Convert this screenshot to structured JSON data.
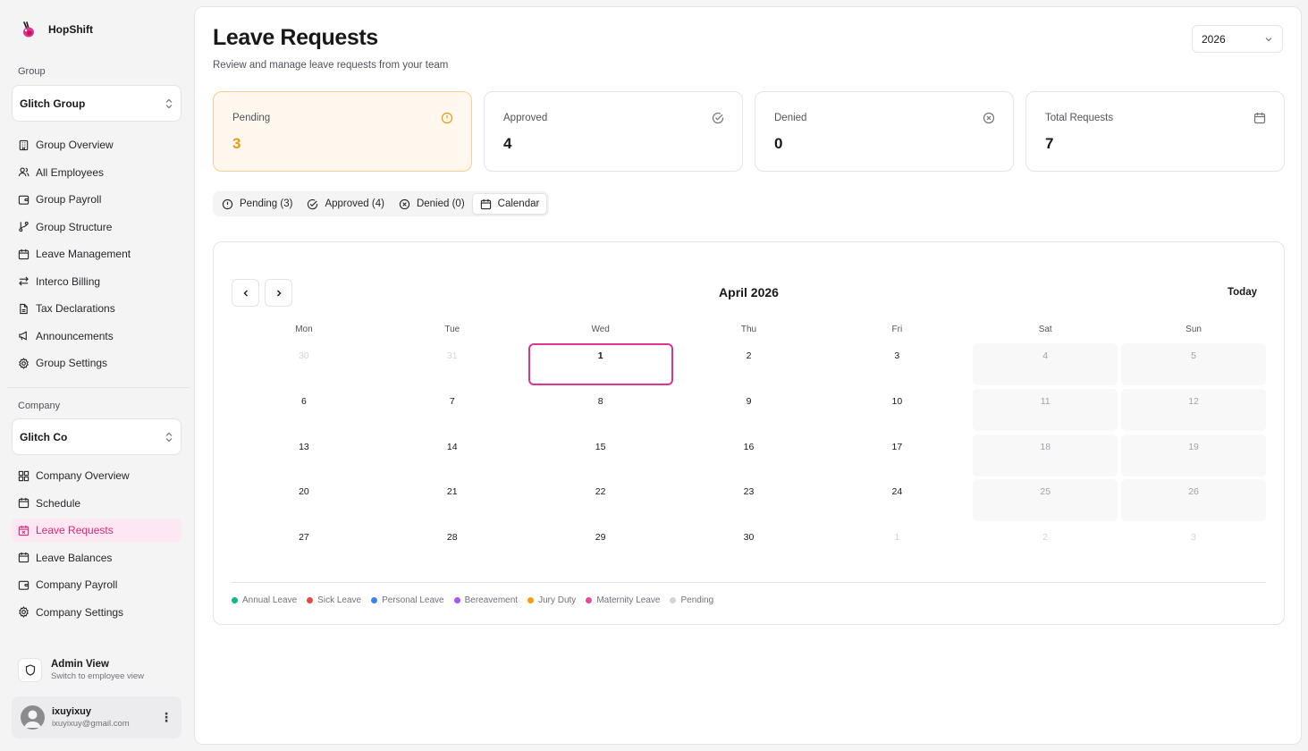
{
  "app": {
    "name": "HopShift"
  },
  "sidebar": {
    "group_label": "Group",
    "group_selected": "Glitch Group",
    "group_items": [
      {
        "label": "Group Overview",
        "icon": "building-icon"
      },
      {
        "label": "All Employees",
        "icon": "users-icon"
      },
      {
        "label": "Group Payroll",
        "icon": "wallet-icon"
      },
      {
        "label": "Group Structure",
        "icon": "git-branch-icon"
      },
      {
        "label": "Leave Management",
        "icon": "calendar-icon"
      },
      {
        "label": "Interco Billing",
        "icon": "arrows-left-right-icon"
      },
      {
        "label": "Tax Declarations",
        "icon": "file-icon"
      },
      {
        "label": "Announcements",
        "icon": "megaphone-icon"
      },
      {
        "label": "Group Settings",
        "icon": "gear-icon"
      }
    ],
    "company_label": "Company",
    "company_selected": "Glitch Co",
    "company_items": [
      {
        "label": "Company Overview",
        "icon": "grid-icon"
      },
      {
        "label": "Schedule",
        "icon": "calendar-icon"
      },
      {
        "label": "Leave Requests",
        "icon": "calendar-x-icon",
        "active": true
      },
      {
        "label": "Leave Balances",
        "icon": "calendar-icon"
      },
      {
        "label": "Company Payroll",
        "icon": "wallet-icon"
      },
      {
        "label": "Company Settings",
        "icon": "gear-icon"
      }
    ],
    "admin": {
      "title": "Admin View",
      "subtitle": "Switch to employee view"
    },
    "user": {
      "name": "ixuyixuy",
      "email": "ixuyixuy@gmail.com"
    }
  },
  "header": {
    "title": "Leave Requests",
    "subtitle": "Review and manage leave requests from your team",
    "year": "2026"
  },
  "stats": [
    {
      "label": "Pending",
      "value": "3",
      "icon": "alert-circle-icon"
    },
    {
      "label": "Approved",
      "value": "4",
      "icon": "check-circle-icon"
    },
    {
      "label": "Denied",
      "value": "0",
      "icon": "x-circle-icon"
    },
    {
      "label": "Total Requests",
      "value": "7",
      "icon": "calendar-icon"
    }
  ],
  "tabs": [
    {
      "label": "Pending (3)",
      "icon": "alert-circle-icon"
    },
    {
      "label": "Approved (4)",
      "icon": "check-circle-icon"
    },
    {
      "label": "Denied (0)",
      "icon": "x-circle-icon"
    },
    {
      "label": "Calendar",
      "icon": "calendar-icon",
      "active": true
    }
  ],
  "calendar": {
    "month_label": "April 2026",
    "today_label": "Today",
    "weekdays": [
      "Mon",
      "Tue",
      "Wed",
      "Thu",
      "Fri",
      "Sat",
      "Sun"
    ],
    "weeks": [
      [
        "30",
        "31",
        "1",
        "2",
        "3",
        "4",
        "5"
      ],
      [
        "6",
        "7",
        "8",
        "9",
        "10",
        "11",
        "12"
      ],
      [
        "13",
        "14",
        "15",
        "16",
        "17",
        "18",
        "19"
      ],
      [
        "20",
        "21",
        "22",
        "23",
        "24",
        "25",
        "26"
      ],
      [
        "27",
        "28",
        "29",
        "30",
        "1",
        "2",
        "3"
      ]
    ],
    "legend": [
      {
        "label": "Annual Leave",
        "color": "#10b981"
      },
      {
        "label": "Sick Leave",
        "color": "#ef4444"
      },
      {
        "label": "Personal Leave",
        "color": "#3b82f6"
      },
      {
        "label": "Bereavement",
        "color": "#a855f7"
      },
      {
        "label": "Jury Duty",
        "color": "#f59e0b"
      },
      {
        "label": "Maternity Leave",
        "color": "#ec4899"
      },
      {
        "label": "Pending",
        "color": "#d4d4d8"
      }
    ]
  },
  "colors": {
    "accent": "#db2777",
    "pending": "#e79a12"
  }
}
